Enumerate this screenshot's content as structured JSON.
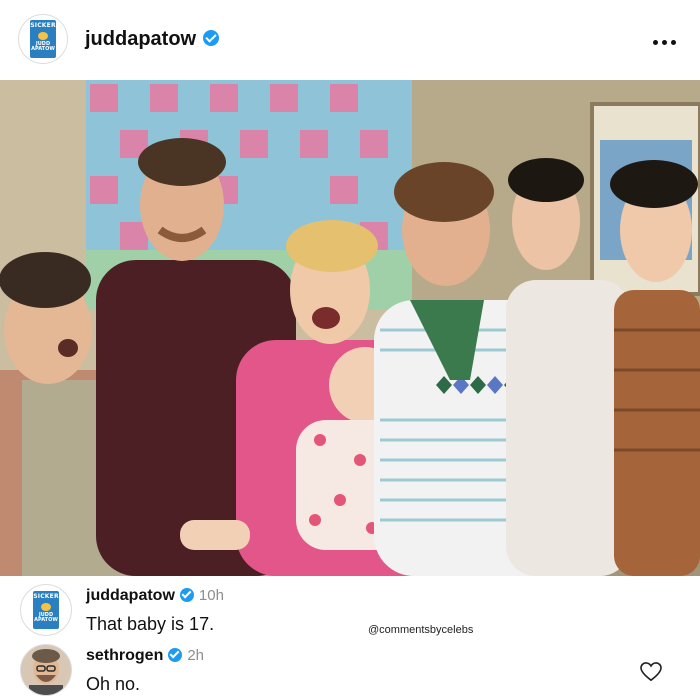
{
  "post": {
    "username": "juddapatow",
    "avatar_book": {
      "line1": "SICKER",
      "line2": "JUDD APATOW"
    },
    "more_icon": "more-horizontal-icon",
    "watermark": "@commentsbycelebs"
  },
  "comments": [
    {
      "username": "juddapatow",
      "time": "10h",
      "text": "That baby is 17."
    },
    {
      "username": "sethrogen",
      "time": "2h",
      "text": "Oh no."
    }
  ],
  "colors": {
    "verified": "#1d9bf0",
    "time": "#8e8e8e",
    "book_blue": "#2a7fc1"
  }
}
